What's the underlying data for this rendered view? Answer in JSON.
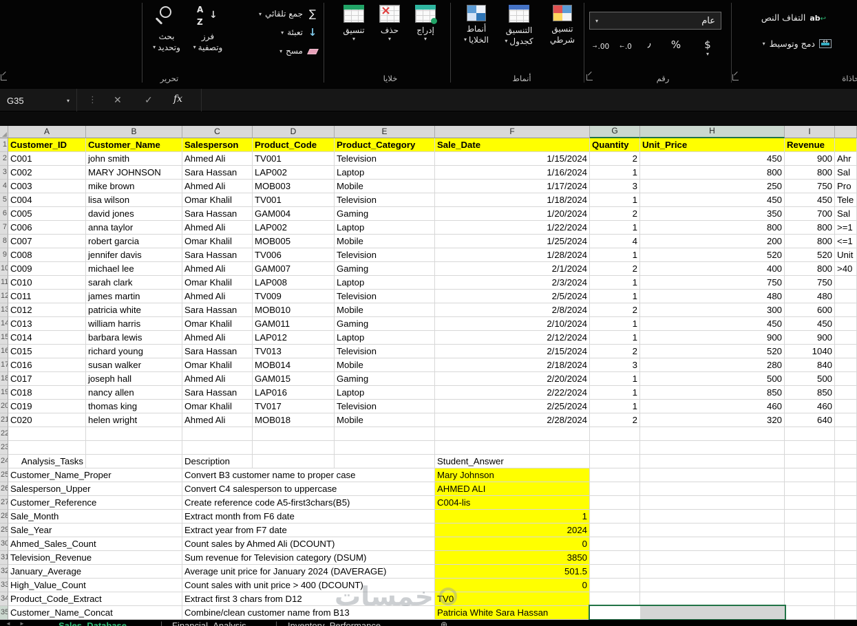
{
  "ribbon": {
    "editing": {
      "label": "تحرير",
      "autosum": "جمع تلقائي",
      "fill": "تعبئة",
      "clear": "مسح",
      "sort_line1": "فرز",
      "sort_line2": "وتصفية",
      "find_line1": "بحث",
      "find_line2": "وتحديد"
    },
    "cells": {
      "label": "خلايا",
      "format": "تنسيق",
      "del": "حذف",
      "insert": "إدراج"
    },
    "styles": {
      "label": "أنماط",
      "cell_styles_1": "أنماط",
      "cell_styles_2": "الخلايا",
      "as_table_1": "التنسيق",
      "as_table_2": "كجدول",
      "conditional_1": "تنسيق",
      "conditional_2": "شرطي"
    },
    "number": {
      "label": "رقم",
      "format": "عام",
      "currency": "$",
      "percent": "%",
      "comma": "٫",
      "inc_dec": ".00",
      "dec_dec": ".0"
    },
    "alignment": {
      "label": "محاذاة",
      "wrap": "التفاف النص",
      "merge": "دمج وتوسيط",
      "wrap_icon": "ab"
    }
  },
  "formula_bar": {
    "name_box": "G35",
    "cancel": "✕",
    "enter": "✓",
    "fx": "fx",
    "value": ""
  },
  "grid": {
    "columns": [
      "A",
      "B",
      "C",
      "D",
      "E",
      "F",
      "G",
      "H",
      "I"
    ],
    "header_row": [
      "Customer_ID",
      "Customer_Name",
      "Salesperson",
      "Product_Code",
      "Product_Category",
      "Sale_Date",
      "Quantity",
      "Unit_Price",
      "Revenue"
    ],
    "rows": [
      [
        "C001",
        "john smith",
        "Ahmed Ali",
        "TV001",
        "Television",
        "1/15/2024",
        "2",
        "450",
        "900"
      ],
      [
        "C002",
        "MARY JOHNSON",
        "Sara Hassan",
        "LAP002",
        "Laptop",
        "1/16/2024",
        "1",
        "800",
        "800"
      ],
      [
        "C003",
        "mike brown",
        "Ahmed Ali",
        "MOB003",
        "Mobile",
        "1/17/2024",
        "3",
        "250",
        "750"
      ],
      [
        "C004",
        "lisa wilson",
        "Omar Khalil",
        "TV001",
        "Television",
        "1/18/2024",
        "1",
        "450",
        "450"
      ],
      [
        "C005",
        "david jones",
        "Sara Hassan",
        "GAM004",
        "Gaming",
        "1/20/2024",
        "2",
        "350",
        "700"
      ],
      [
        "C006",
        "anna taylor",
        "Ahmed Ali",
        "LAP002",
        "Laptop",
        "1/22/2024",
        "1",
        "800",
        "800"
      ],
      [
        "C007",
        "robert garcia",
        "Omar Khalil",
        "MOB005",
        "Mobile",
        "1/25/2024",
        "4",
        "200",
        "800"
      ],
      [
        "C008",
        "jennifer davis",
        "Sara Hassan",
        "TV006",
        "Television",
        "1/28/2024",
        "1",
        "520",
        "520"
      ],
      [
        "C009",
        "michael lee",
        "Ahmed Ali",
        "GAM007",
        "Gaming",
        "2/1/2024",
        "2",
        "400",
        "800"
      ],
      [
        "C010",
        "sarah clark",
        "Omar Khalil",
        "LAP008",
        "Laptop",
        "2/3/2024",
        "1",
        "750",
        "750"
      ],
      [
        "C011",
        "james martin",
        "Ahmed Ali",
        "TV009",
        "Television",
        "2/5/2024",
        "1",
        "480",
        "480"
      ],
      [
        "C012",
        "patricia white",
        "Sara Hassan",
        "MOB010",
        "Mobile",
        "2/8/2024",
        "2",
        "300",
        "600"
      ],
      [
        "C013",
        "william harris",
        "Omar Khalil",
        "GAM011",
        "Gaming",
        "2/10/2024",
        "1",
        "450",
        "450"
      ],
      [
        "C014",
        "barbara lewis",
        "Ahmed Ali",
        "LAP012",
        "Laptop",
        "2/12/2024",
        "1",
        "900",
        "900"
      ],
      [
        "C015",
        "richard young",
        "Sara Hassan",
        "TV013",
        "Television",
        "2/15/2024",
        "2",
        "520",
        "1040"
      ],
      [
        "C016",
        "susan walker",
        "Omar Khalil",
        "MOB014",
        "Mobile",
        "2/18/2024",
        "3",
        "280",
        "840"
      ],
      [
        "C017",
        "joseph hall",
        "Ahmed Ali",
        "GAM015",
        "Gaming",
        "2/20/2024",
        "1",
        "500",
        "500"
      ],
      [
        "C018",
        "nancy allen",
        "Sara Hassan",
        "LAP016",
        "Laptop",
        "2/22/2024",
        "1",
        "850",
        "850"
      ],
      [
        "C019",
        "thomas king",
        "Omar Khalil",
        "TV017",
        "Television",
        "2/25/2024",
        "1",
        "460",
        "460"
      ],
      [
        "C020",
        "helen wright",
        "Ahmed Ali",
        "MOB018",
        "Mobile",
        "2/28/2024",
        "2",
        "320",
        "640"
      ]
    ],
    "clipped_right_column": [
      "Ahr",
      "Sal",
      "Pro",
      "Tele",
      "Sal",
      ">=1",
      "<=1",
      "Unit",
      ">40"
    ],
    "analysis": {
      "section_title": "Analysis_Tasks",
      "description_header": "Description",
      "answer_header": "Student_Answer",
      "tasks": [
        {
          "name": "Customer_Name_Proper",
          "description": "Convert B3 customer name to proper case",
          "answer": "Mary Johnson",
          "numeric": false
        },
        {
          "name": "Salesperson_Upper",
          "description": "Convert C4 salesperson to uppercase",
          "answer": "AHMED ALI",
          "numeric": false
        },
        {
          "name": "Customer_Reference",
          "description": "Create reference code A5-first3chars(B5)",
          "answer": "C004-lis",
          "numeric": false
        },
        {
          "name": "Sale_Month",
          "description": "Extract month from F6 date",
          "answer": "1",
          "numeric": true
        },
        {
          "name": "Sale_Year",
          "description": "Extract year from F7 date",
          "answer": "2024",
          "numeric": true
        },
        {
          "name": "Ahmed_Sales_Count",
          "description": "Count sales by Ahmed Ali (DCOUNT)",
          "answer": "0",
          "numeric": true
        },
        {
          "name": "Television_Revenue",
          "description": "Sum revenue for Television category (DSUM)",
          "answer": "3850",
          "numeric": true
        },
        {
          "name": "January_Average",
          "description": "Average unit price for January 2024 (DAVERAGE)",
          "answer": "501.5",
          "numeric": true
        },
        {
          "name": "High_Value_Count",
          "description": "Count sales with unit price > 400 (DCOUNT)",
          "answer": "0",
          "numeric": true
        },
        {
          "name": "Product_Code_Extract",
          "description": "Extract first 3 chars from D12",
          "answer": "TV0",
          "numeric": false
        },
        {
          "name": "Customer_Name_Concat",
          "description": "Combine/clean customer name from B13",
          "answer": "Patricia White Sara Hassan",
          "numeric": false
        }
      ]
    },
    "selection": {
      "active_cell": "G35",
      "range": "G35:H35"
    }
  },
  "sheet_tabs": {
    "active": "Sales_Database",
    "tabs": [
      "Sales_Database",
      "Financial_Analysis",
      "Inventory_Performance"
    ],
    "add_icon": "⊕"
  },
  "watermark": "خمسات",
  "colors": {
    "header_fill": "#ffff00",
    "answer_fill": "#ffff00",
    "selection_border": "#217346",
    "active_tab": "#2ebd77"
  }
}
